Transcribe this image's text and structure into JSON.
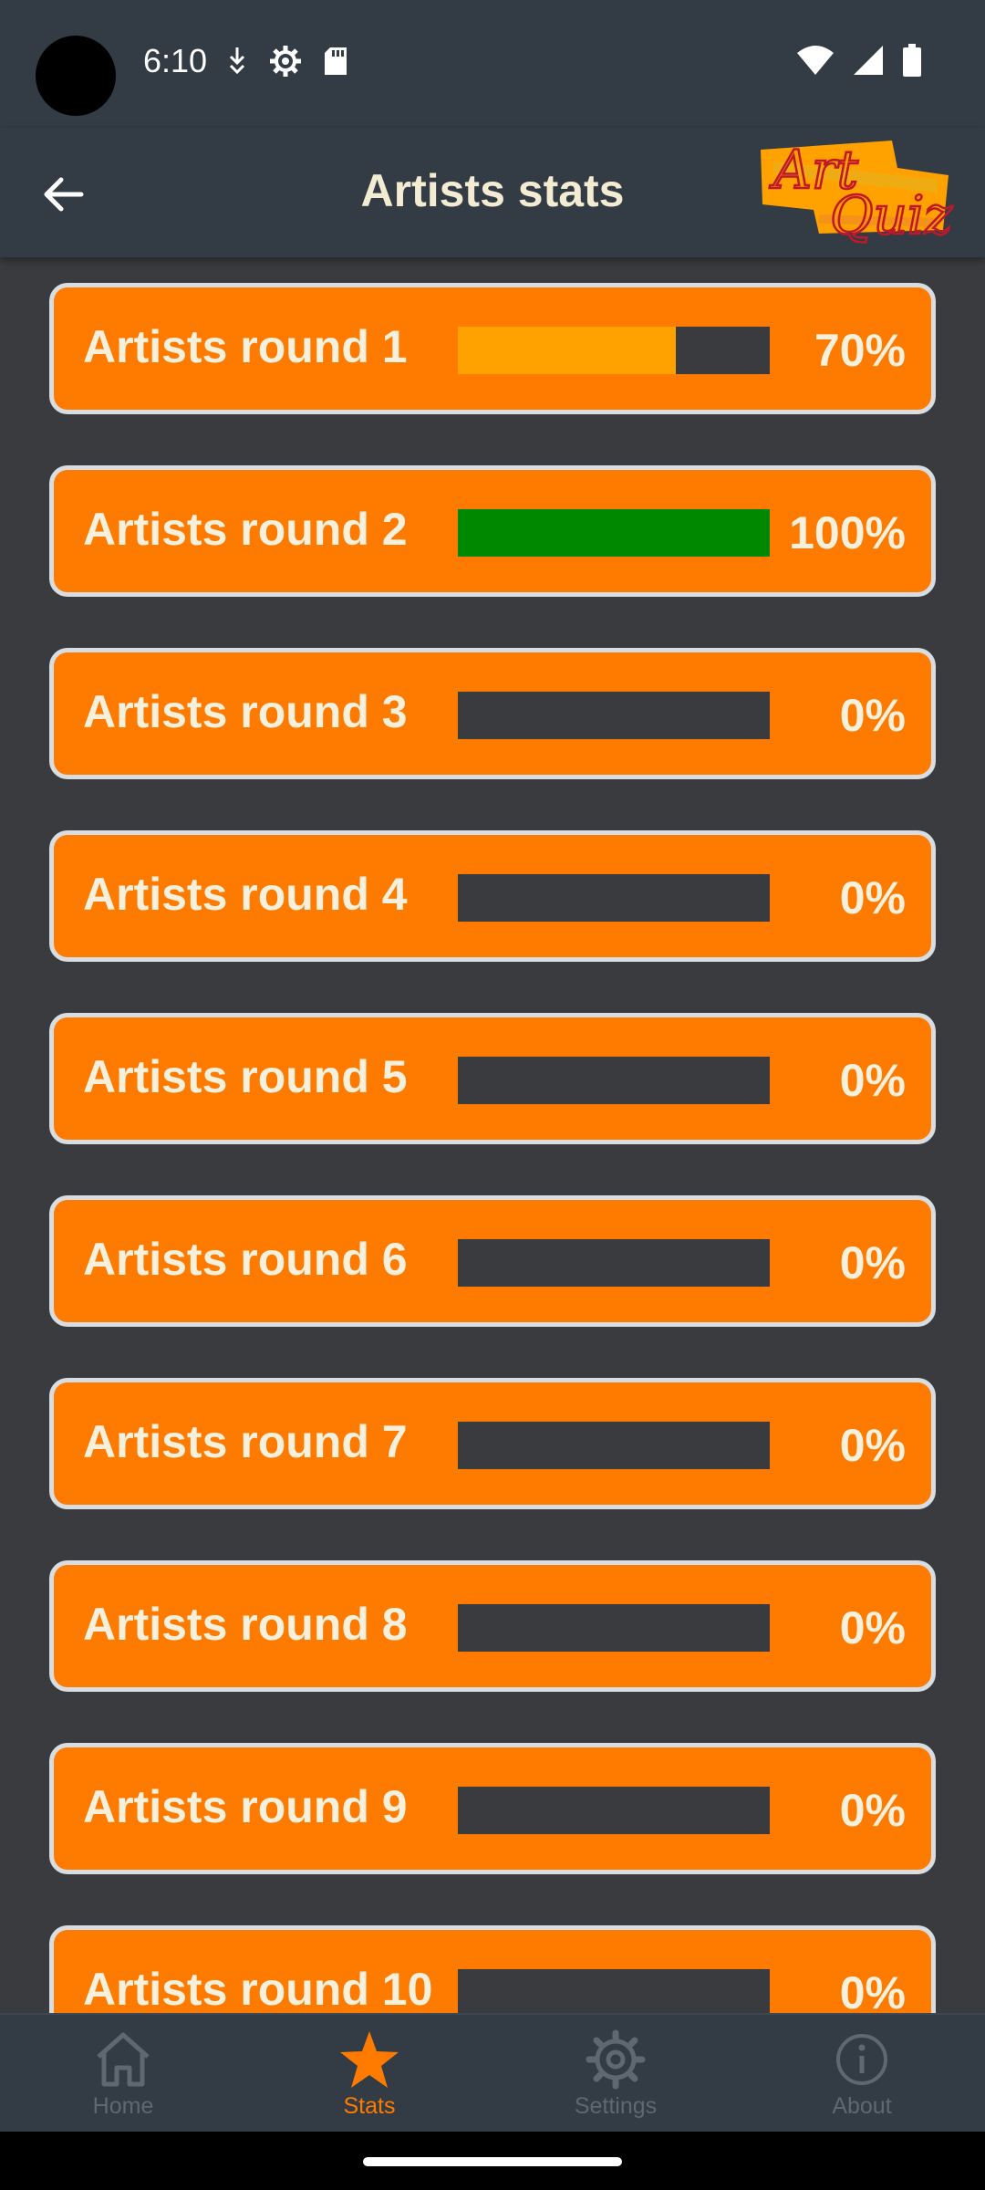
{
  "status_bar": {
    "time": "6:10",
    "icons_left": [
      "download-icon",
      "settings-gear-icon",
      "sd-card-icon"
    ],
    "icons_right": [
      "wifi-icon",
      "cell-signal-icon",
      "battery-icon"
    ]
  },
  "app_bar": {
    "title": "Artists stats",
    "logo_line1": "Art",
    "logo_line2": "Quiz"
  },
  "colors": {
    "accent": "#ff7b00",
    "bar_bg": "#333b44",
    "page_bg": "#3a3b3e",
    "progress_partial": "#ffa200",
    "progress_complete": "#008800",
    "text_light": "#f6f0dc",
    "nav_inactive": "#5f6770"
  },
  "rounds": [
    {
      "name": "Artists round 1",
      "percent_label": "70%",
      "progress": 0.7,
      "color": "#ffa200"
    },
    {
      "name": "Artists round 2",
      "percent_label": "100%",
      "progress": 1.0,
      "color": "#008800"
    },
    {
      "name": "Artists round 3",
      "percent_label": "0%",
      "progress": 0,
      "color": "#ffa200"
    },
    {
      "name": "Artists round 4",
      "percent_label": "0%",
      "progress": 0,
      "color": "#ffa200"
    },
    {
      "name": "Artists round 5",
      "percent_label": "0%",
      "progress": 0,
      "color": "#ffa200"
    },
    {
      "name": "Artists round 6",
      "percent_label": "0%",
      "progress": 0,
      "color": "#ffa200"
    },
    {
      "name": "Artists round 7",
      "percent_label": "0%",
      "progress": 0,
      "color": "#ffa200"
    },
    {
      "name": "Artists round 8",
      "percent_label": "0%",
      "progress": 0,
      "color": "#ffa200"
    },
    {
      "name": "Artists round 9",
      "percent_label": "0%",
      "progress": 0,
      "color": "#ffa200"
    },
    {
      "name": "Artists round 10",
      "percent_label": "0%",
      "progress": 0,
      "color": "#ffa200"
    }
  ],
  "bottom_nav": {
    "items": [
      {
        "label": "Home",
        "icon": "home-icon",
        "active": false
      },
      {
        "label": "Stats",
        "icon": "star-icon",
        "active": true
      },
      {
        "label": "Settings",
        "icon": "gear-icon",
        "active": false
      },
      {
        "label": "About",
        "icon": "info-icon",
        "active": false
      }
    ]
  }
}
